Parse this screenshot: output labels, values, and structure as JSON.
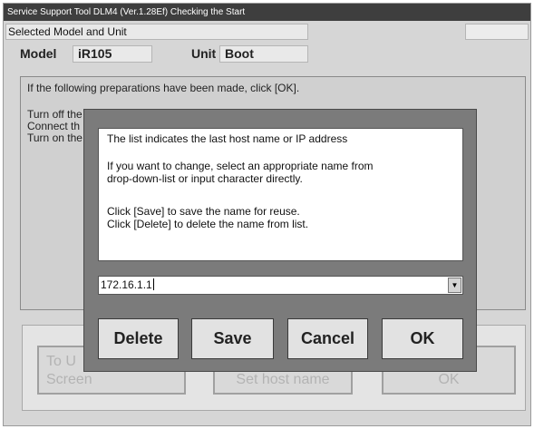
{
  "window": {
    "title": "Service Support Tool DLM4 (Ver.1.28Ef) Checking the Start",
    "selected_model_label": "Selected Model and Unit"
  },
  "model": {
    "label": "Model",
    "value": "iR105"
  },
  "unit": {
    "label": "Unit",
    "value": "Boot"
  },
  "main": {
    "instruction": "If the following preparations have been made, click [OK].",
    "steps": [
      "Turn off the",
      "Connect th",
      "Turn on the"
    ]
  },
  "background_buttons": {
    "to_upper": "To Upper Screen",
    "to_upper_line1": "To U",
    "to_upper_line2": "Screen",
    "set_host": "Set host name",
    "ok": "OK"
  },
  "dialog": {
    "message_lines": [
      "The list indicates the last host name or IP address",
      "If you want to change, select an appropriate name from",
      "drop-down-list or input character directly.",
      "Click [Save] to save the name for reuse.",
      "Click [Delete] to delete the name from list."
    ],
    "host_value": "172.16.1.1",
    "buttons": {
      "delete": "Delete",
      "save": "Save",
      "cancel": "Cancel",
      "ok": "OK"
    }
  }
}
